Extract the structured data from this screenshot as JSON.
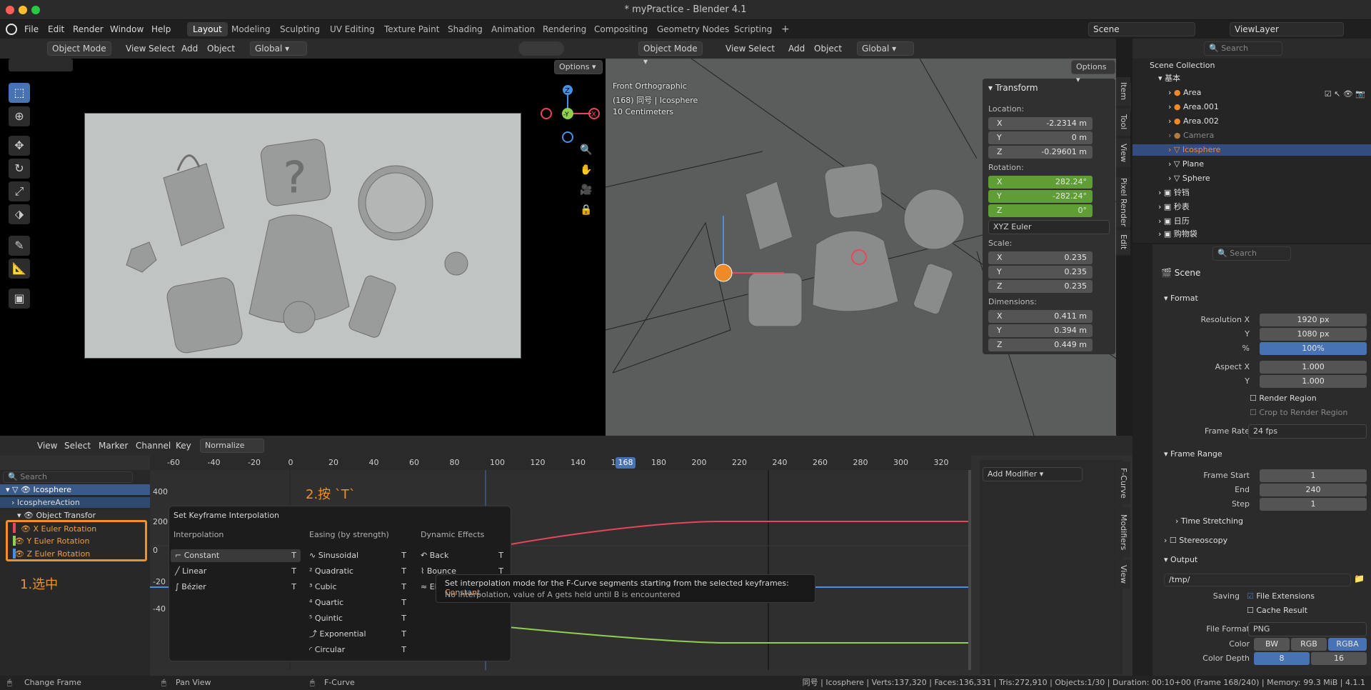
{
  "window": {
    "title": "* myPractice - Blender 4.1"
  },
  "colors": {
    "accent": "#4772b3",
    "selected_orange": "#f08a28",
    "x_red": "#e8465a",
    "y_green": "#8fd14f",
    "z_blue": "#4a90e2",
    "annotation": "#f0902a"
  },
  "menubar": {
    "items": [
      "File",
      "Edit",
      "Render",
      "Window",
      "Help"
    ]
  },
  "workspaces": [
    "Layout",
    "Modeling",
    "Sculpting",
    "UV Editing",
    "Texture Paint",
    "Shading",
    "Animation",
    "Rendering",
    "Compositing",
    "Geometry Nodes",
    "Scripting"
  ],
  "scene": {
    "label": "Scene",
    "viewlayer": "ViewLayer"
  },
  "viewport_left": {
    "mode": "Object Mode",
    "menus": [
      "View",
      "Select",
      "Add",
      "Object"
    ],
    "orientation": "Global",
    "options": "Options"
  },
  "viewport_right": {
    "mode": "Object Mode",
    "menus": [
      "View",
      "Select",
      "Add",
      "Object"
    ],
    "orientation": "Global",
    "options": "Options",
    "overlay": {
      "line1": "Front Orthographic",
      "line2": "(168) 同号 | Icosphere",
      "line3": "10 Centimeters"
    },
    "side_tabs": [
      "Item",
      "Tool",
      "View",
      "Pixel Render",
      "Edit"
    ]
  },
  "transform": {
    "title": "Transform",
    "location_label": "Location:",
    "location": [
      {
        "axis": "X",
        "value": "-2.2314 m"
      },
      {
        "axis": "Y",
        "value": "0 m"
      },
      {
        "axis": "Z",
        "value": "-0.29601 m"
      }
    ],
    "rotation_label": "Rotation:",
    "rotation": [
      {
        "axis": "X",
        "value": "282.24°"
      },
      {
        "axis": "Y",
        "value": "-282.24°"
      },
      {
        "axis": "Z",
        "value": "0°"
      }
    ],
    "rotation_mode": "XYZ Euler",
    "scale_label": "Scale:",
    "scale": [
      {
        "axis": "X",
        "value": "0.235"
      },
      {
        "axis": "Y",
        "value": "0.235"
      },
      {
        "axis": "Z",
        "value": "0.235"
      }
    ],
    "dimensions_label": "Dimensions:",
    "dimensions": [
      {
        "axis": "X",
        "value": "0.411 m"
      },
      {
        "axis": "Y",
        "value": "0.394 m"
      },
      {
        "axis": "Z",
        "value": "0.449 m"
      }
    ]
  },
  "outliner": {
    "search_placeholder": "Search",
    "root": "Scene Collection",
    "collection": "基本",
    "items": [
      {
        "name": "Area",
        "selected": false
      },
      {
        "name": "Area.001",
        "selected": false
      },
      {
        "name": "Area.002",
        "selected": false
      },
      {
        "name": "Camera",
        "selected": false
      },
      {
        "name": "Icosphere",
        "selected": true
      },
      {
        "name": "Plane",
        "selected": false
      },
      {
        "name": "Sphere",
        "selected": false
      }
    ],
    "collections": [
      "铃铛",
      "秒表",
      "日历",
      "购物袋"
    ]
  },
  "properties": {
    "search_placeholder": "Search",
    "context": "Scene",
    "format": {
      "title": "Format",
      "res_x_label": "Resolution X",
      "res_x": "1920 px",
      "res_y_label": "Y",
      "res_y": "1080 px",
      "pct_label": "%",
      "pct": "100%",
      "aspect_x_label": "Aspect X",
      "aspect_x": "1.000",
      "aspect_y_label": "Y",
      "aspect_y": "1.000",
      "render_region": "Render Region",
      "crop": "Crop to Render Region",
      "frame_rate_label": "Frame Rate",
      "frame_rate": "24 fps"
    },
    "frame_range": {
      "title": "Frame Range",
      "start_label": "Frame Start",
      "start": "1",
      "end_label": "End",
      "end": "240",
      "step_label": "Step",
      "step": "1",
      "time_stretching": "Time Stretching"
    },
    "stereoscopy": "Stereoscopy",
    "output": {
      "title": "Output",
      "path": "/tmp/",
      "saving_label": "Saving",
      "file_extensions": "File Extensions",
      "cache_result": "Cache Result",
      "file_format_label": "File Format",
      "file_format": "PNG",
      "color_label": "Color",
      "color_options": [
        "BW",
        "RGB",
        "RGBA"
      ],
      "depth_label": "Color Depth",
      "depth_options": [
        "8",
        "16"
      ]
    }
  },
  "graph_editor": {
    "menus": [
      "View",
      "Select",
      "Marker",
      "Channel",
      "Key"
    ],
    "normalize": "Normalize",
    "search_placeholder": "Search",
    "ruler": [
      "-60",
      "-40",
      "-20",
      "0",
      "20",
      "40",
      "60",
      "80",
      "100",
      "120",
      "140",
      "160",
      "180",
      "200",
      "220",
      "240",
      "260",
      "280",
      "300",
      "320"
    ],
    "current_frame": "168",
    "y_labels": [
      "400",
      "200",
      "0",
      "-20",
      "-40"
    ],
    "channels": {
      "object": "Icosphere",
      "action": "IcosphereAction",
      "group": "Object Transfor",
      "curves": [
        {
          "name": "X Euler Rotation",
          "color": "#e8465a"
        },
        {
          "name": "Y Euler Rotation",
          "color": "#8fd14f"
        },
        {
          "name": "Z Euler Rotation",
          "color": "#4a90e2"
        }
      ]
    },
    "add_modifier": "Add Modifier",
    "side_tabs": [
      "F-Curve",
      "Modifiers",
      "View"
    ],
    "annotation_select": "1.选中",
    "annotation_press": "2.按 `T`"
  },
  "interp_menu": {
    "title": "Set Keyframe Interpolation",
    "col1_title": "Interpolation",
    "col1": [
      {
        "label": "Constant",
        "key": "T"
      },
      {
        "label": "Linear",
        "key": "T"
      },
      {
        "label": "Bézier",
        "key": "T"
      }
    ],
    "col2_title": "Easing (by strength)",
    "col2": [
      {
        "label": "Sinusoidal",
        "key": "T"
      },
      {
        "label": "Quadratic",
        "key": "T"
      },
      {
        "label": "Cubic",
        "key": "T"
      },
      {
        "label": "Quartic",
        "key": "T"
      },
      {
        "label": "Quintic",
        "key": "T"
      },
      {
        "label": "Exponential",
        "key": "T"
      },
      {
        "label": "Circular",
        "key": "T"
      }
    ],
    "col3_title": "Dynamic Effects",
    "col3": [
      {
        "label": "Back",
        "key": "T"
      },
      {
        "label": "Bounce",
        "key": "T"
      },
      {
        "label": "Elastic",
        "key": "T"
      }
    ]
  },
  "tooltip": {
    "line1": "Set interpolation mode for the F-Curve segments starting from the selected keyframes:",
    "line1_value": "Constant",
    "line2": "No interpolation, value of A gets held until B is encountered"
  },
  "statusbar": {
    "left1": "Change Frame",
    "left2": "Pan View",
    "left3": "F-Curve",
    "right": "同号 | Icosphere | Verts:137,320 | Faces:136,331 | Tris:272,910 | Objects:1/30 | Duration: 00:10+00 (Frame 168/240) | Memory: 99.3 MiB | 4.1.1"
  }
}
